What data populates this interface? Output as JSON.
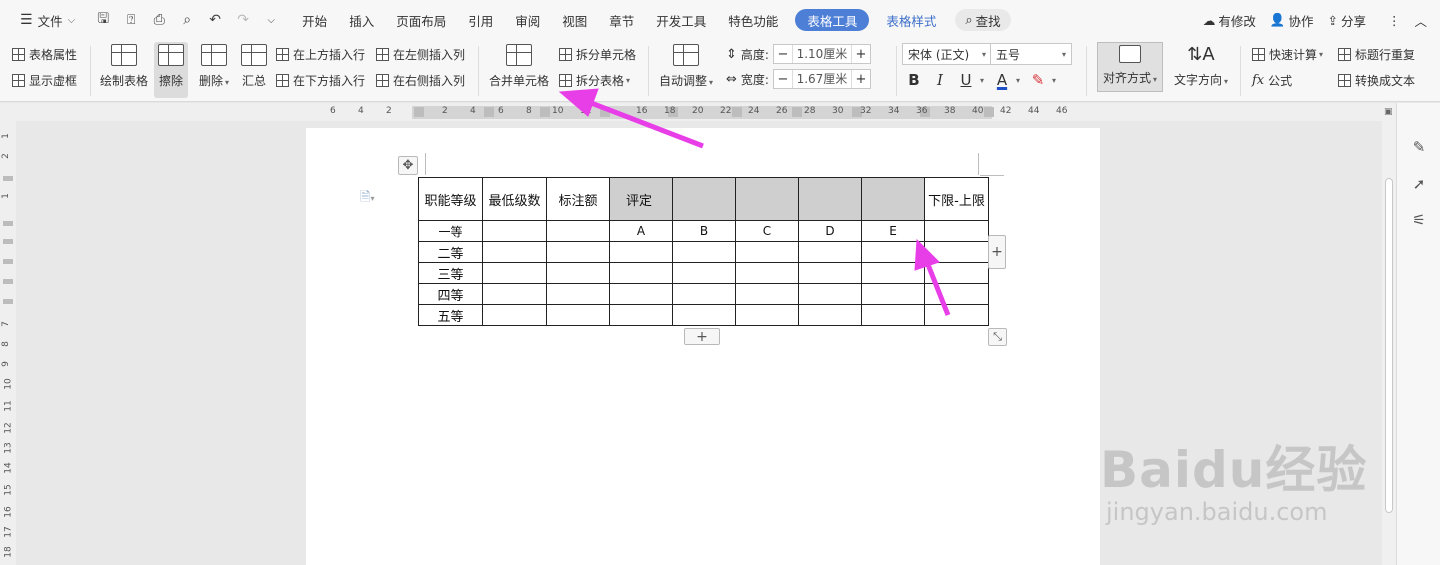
{
  "tabbar": {
    "file": "文件",
    "tabs": [
      "开始",
      "插入",
      "页面布局",
      "引用",
      "审阅",
      "视图",
      "章节",
      "开发工具",
      "特色功能"
    ],
    "active_tab": "表格工具",
    "extra_tab": "表格样式",
    "search": "查找",
    "right": {
      "modified": "有修改",
      "collab": "协作",
      "share": "分享"
    }
  },
  "ribbon": {
    "table_props": "表格属性",
    "show_grid": "显示虚框",
    "draw_table": "绘制表格",
    "erase": "擦除",
    "delete": "删除",
    "summary": "汇总",
    "insert_above": "在上方插入行",
    "insert_below": "在下方插入行",
    "insert_left": "在左侧插入列",
    "insert_right": "在右侧插入列",
    "merge_cells": "合并单元格",
    "split_cells": "拆分单元格",
    "split_table": "拆分表格",
    "auto_adjust": "自动调整",
    "height_label": "高度:",
    "height_value": "1.10厘米",
    "width_label": "宽度:",
    "width_value": "1.67厘米",
    "font_name": "宋体 (正文)",
    "font_size": "五号",
    "bold": "B",
    "italic": "I",
    "underline": "U",
    "font_color": "A",
    "align": "对齐方式",
    "text_dir": "文字方向",
    "quick_calc": "快速计算",
    "repeat_header": "标题行重复",
    "formula": "公式",
    "to_text": "转换成文本"
  },
  "ruler": {
    "h": [
      "6",
      "4",
      "2",
      "2",
      "4",
      "6",
      "8",
      "10",
      "12",
      "16",
      "18",
      "20",
      "22",
      "24",
      "26",
      "28",
      "30",
      "32",
      "34",
      "36",
      "38",
      "40",
      "42",
      "44",
      "46"
    ],
    "v": [
      "1",
      "2",
      "1",
      "1",
      "7",
      "8",
      "9",
      "10",
      "11",
      "12",
      "13",
      "14",
      "15",
      "16",
      "17",
      "18"
    ]
  },
  "table": {
    "header": [
      "职能等级",
      "最低级数",
      "标注额",
      "评定",
      "",
      "",
      "",
      "",
      "下限-上限"
    ],
    "rows": [
      [
        "一等",
        "",
        "",
        "A",
        "B",
        "C",
        "D",
        "E",
        ""
      ],
      [
        "二等",
        "",
        "",
        "",
        "",
        "",
        "",
        "",
        ""
      ],
      [
        "三等",
        "",
        "",
        "",
        "",
        "",
        "",
        "",
        ""
      ],
      [
        "四等",
        "",
        "",
        "",
        "",
        "",
        "",
        "",
        ""
      ],
      [
        "五等",
        "",
        "",
        "",
        "",
        "",
        "",
        "",
        ""
      ]
    ]
  },
  "watermark": {
    "big": "Baidu经验",
    "small": "jingyan.baidu.com"
  },
  "colors": {
    "accent": "#4e7fd6",
    "arrow": "#e83ee8",
    "cell_gray": "#cfcfcf"
  }
}
